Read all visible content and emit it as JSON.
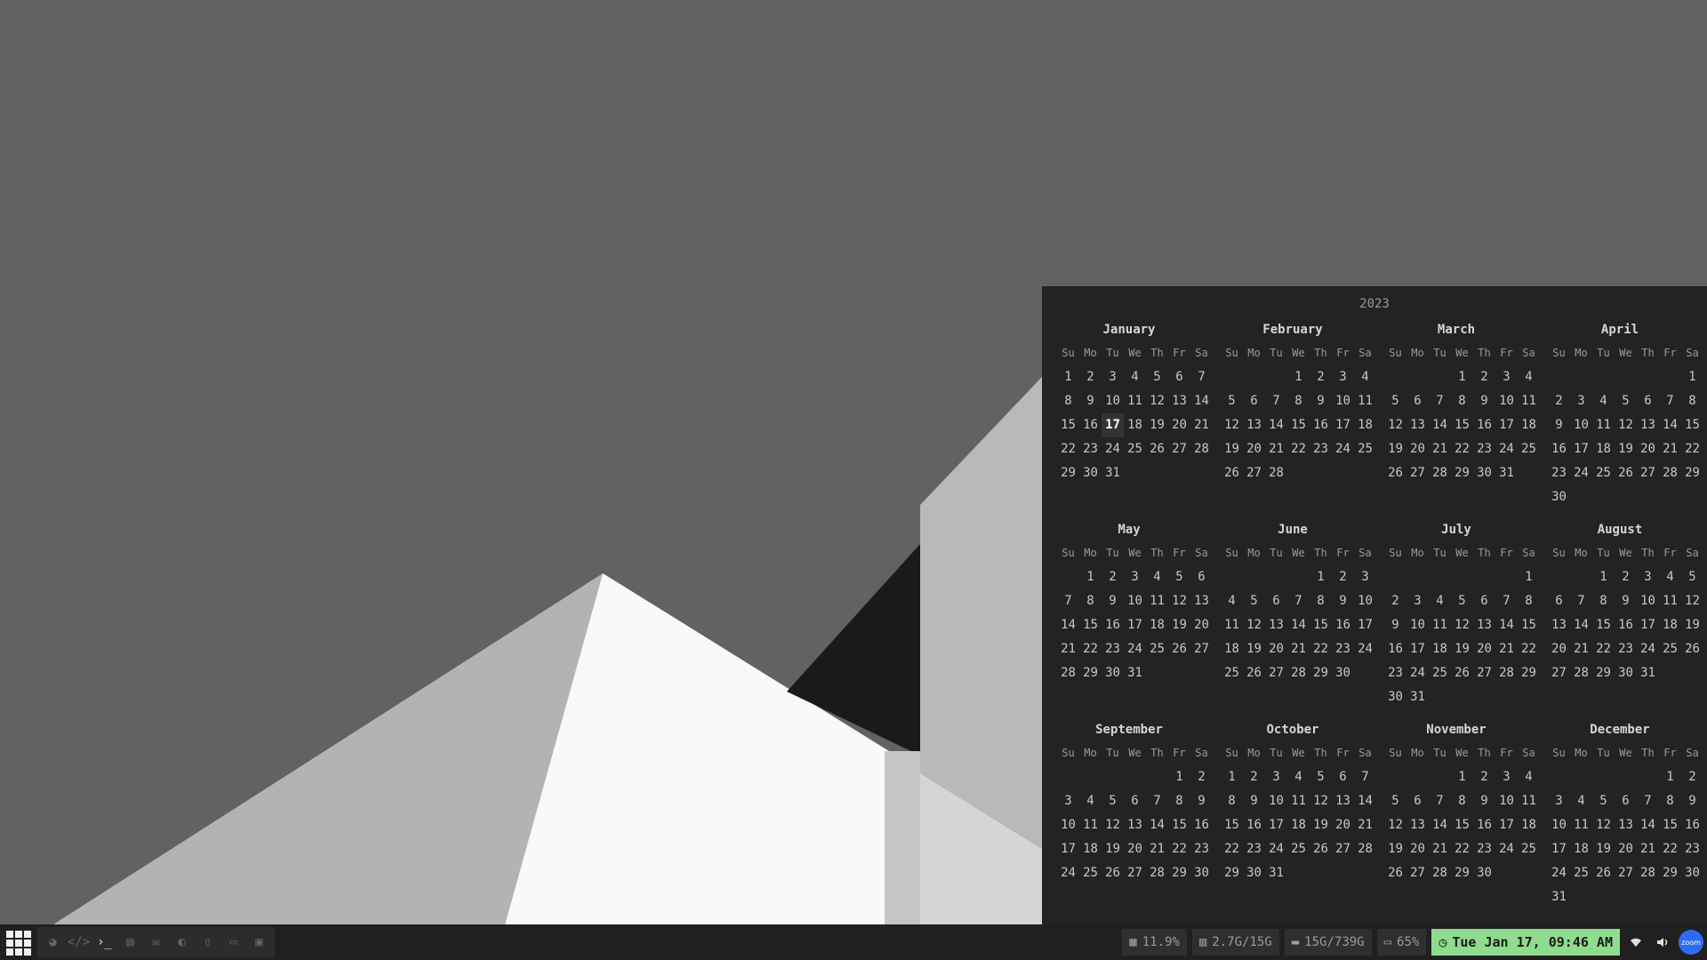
{
  "colors": {
    "desktop_bg": "#626262",
    "clock_bg": "#8fdc8f",
    "zoom_bg": "#2d6cf0"
  },
  "calendar": {
    "year": "2023",
    "today": {
      "month": 0,
      "day": 17
    },
    "weekdays": [
      "Su",
      "Mo",
      "Tu",
      "We",
      "Th",
      "Fr",
      "Sa"
    ],
    "months": [
      {
        "name": "January",
        "first_weekday": 0,
        "days": 31
      },
      {
        "name": "February",
        "first_weekday": 3,
        "days": 28
      },
      {
        "name": "March",
        "first_weekday": 3,
        "days": 31
      },
      {
        "name": "April",
        "first_weekday": 6,
        "days": 30
      },
      {
        "name": "May",
        "first_weekday": 1,
        "days": 31
      },
      {
        "name": "June",
        "first_weekday": 4,
        "days": 30
      },
      {
        "name": "July",
        "first_weekday": 6,
        "days": 31
      },
      {
        "name": "August",
        "first_weekday": 2,
        "days": 31
      },
      {
        "name": "September",
        "first_weekday": 5,
        "days": 30
      },
      {
        "name": "October",
        "first_weekday": 0,
        "days": 31
      },
      {
        "name": "November",
        "first_weekday": 3,
        "days": 30
      },
      {
        "name": "December",
        "first_weekday": 5,
        "days": 31
      }
    ]
  },
  "taskbar": {
    "apps": [
      {
        "name": "firefox-icon",
        "glyph": "◕",
        "active": false
      },
      {
        "name": "code-editor-icon",
        "glyph": "</>",
        "active": false
      },
      {
        "name": "terminal-icon",
        "glyph": "›_",
        "active": true
      },
      {
        "name": "store-icon",
        "glyph": "▤",
        "active": false
      },
      {
        "name": "chat-icon",
        "glyph": "✉",
        "active": false
      },
      {
        "name": "palette-icon",
        "glyph": "◐",
        "active": false
      },
      {
        "name": "document-icon",
        "glyph": "▯",
        "active": false
      },
      {
        "name": "display-icon",
        "glyph": "▭",
        "active": false
      },
      {
        "name": "lock-icon",
        "glyph": "▣",
        "active": false
      }
    ],
    "cpu": "11.9%",
    "memory": "2.7G/15G",
    "disk": "15G/739G",
    "battery": "65%",
    "clock": "Tue Jan 17, 09:46 AM",
    "zoom_label": "zoom"
  }
}
